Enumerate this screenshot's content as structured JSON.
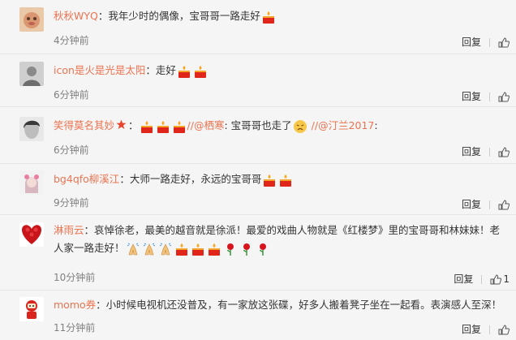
{
  "colors": {
    "username": "#eb7350",
    "time": "#808080",
    "text": "#333333",
    "background": "#f5f5f5"
  },
  "comments": [
    {
      "username": "秋秋WYQ",
      "text": "：我年少时的偶像，宝哥哥一路走好",
      "emoticons": [
        "candle-icon"
      ],
      "time": "4分钟前",
      "reply_label": "回复"
    },
    {
      "username": "icon是火是光是太阳",
      "text": "：走好",
      "emoticons": [
        "candle-icon",
        "candle-icon"
      ],
      "time": "6分钟前",
      "reply_label": "回复"
    },
    {
      "username": "笑得莫名其妙",
      "text_prefix": "：",
      "emoticons": [
        "candle-icon",
        "candle-icon",
        "candle-icon"
      ],
      "mention1": "//@栖寒",
      "text_mid": ":  宝哥哥也走了",
      "mention2": "//@汀兰2017",
      "text_end": ":",
      "time": "6分钟前",
      "reply_label": "回复"
    },
    {
      "username": "bg4qfo柳溪江",
      "text": "：大师一路走好，永远的宝哥哥",
      "emoticons": [
        "candle-icon",
        "candle-icon"
      ],
      "time": "9分钟前",
      "reply_label": "回复"
    },
    {
      "username": "淋雨云",
      "text": "：哀悼徐老，最美的越音就是徐派！最爱的戏曲人物就是《红楼梦》里的宝哥哥和林妹妹！老人家一路走好！",
      "emoticons": [
        "pray-icon",
        "pray-icon",
        "pray-icon",
        "candle-icon",
        "candle-icon",
        "candle-icon",
        "rose-icon",
        "rose-icon",
        "rose-icon"
      ],
      "time": "10分钟前",
      "reply_label": "回复",
      "like_count": "1"
    },
    {
      "username": "momo券",
      "text": "：小时候电视机还没普及，有一家放这张碟，好多人搬着凳子坐在一起看。表演感人至深！",
      "time": "11分钟前",
      "reply_label": "回复"
    }
  ]
}
